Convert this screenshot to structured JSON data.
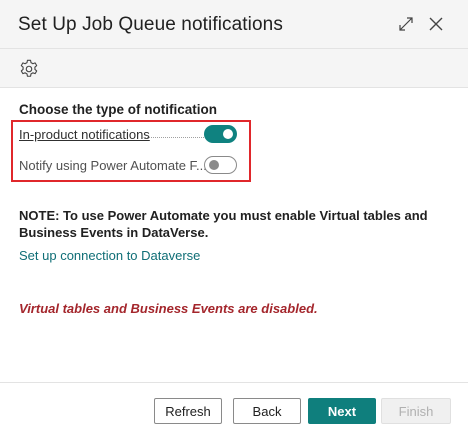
{
  "dialog": {
    "title": "Set Up Job Queue notifications",
    "icons": {
      "expand": "expand-icon",
      "close": "close-icon"
    }
  },
  "toolbar": {
    "icon": "gear-icon"
  },
  "notification_type": {
    "heading": "Choose the type of notification",
    "options": [
      {
        "label": "In-product notifications",
        "enabled": true
      },
      {
        "label": "Notify using Power Automate F...",
        "enabled": false
      }
    ]
  },
  "note": "NOTE: To use Power Automate you must enable Virtual tables and Business Events in DataVerse.",
  "link": "Set up connection to Dataverse",
  "warning": "Virtual tables and Business Events are disabled.",
  "buttons": {
    "refresh": "Refresh",
    "back": "Back",
    "next": "Next",
    "finish": "Finish"
  },
  "colors": {
    "accent": "#0f7f7d",
    "highlight": "#e0272b",
    "warning": "#a4262c",
    "link": "#0f6e76"
  }
}
